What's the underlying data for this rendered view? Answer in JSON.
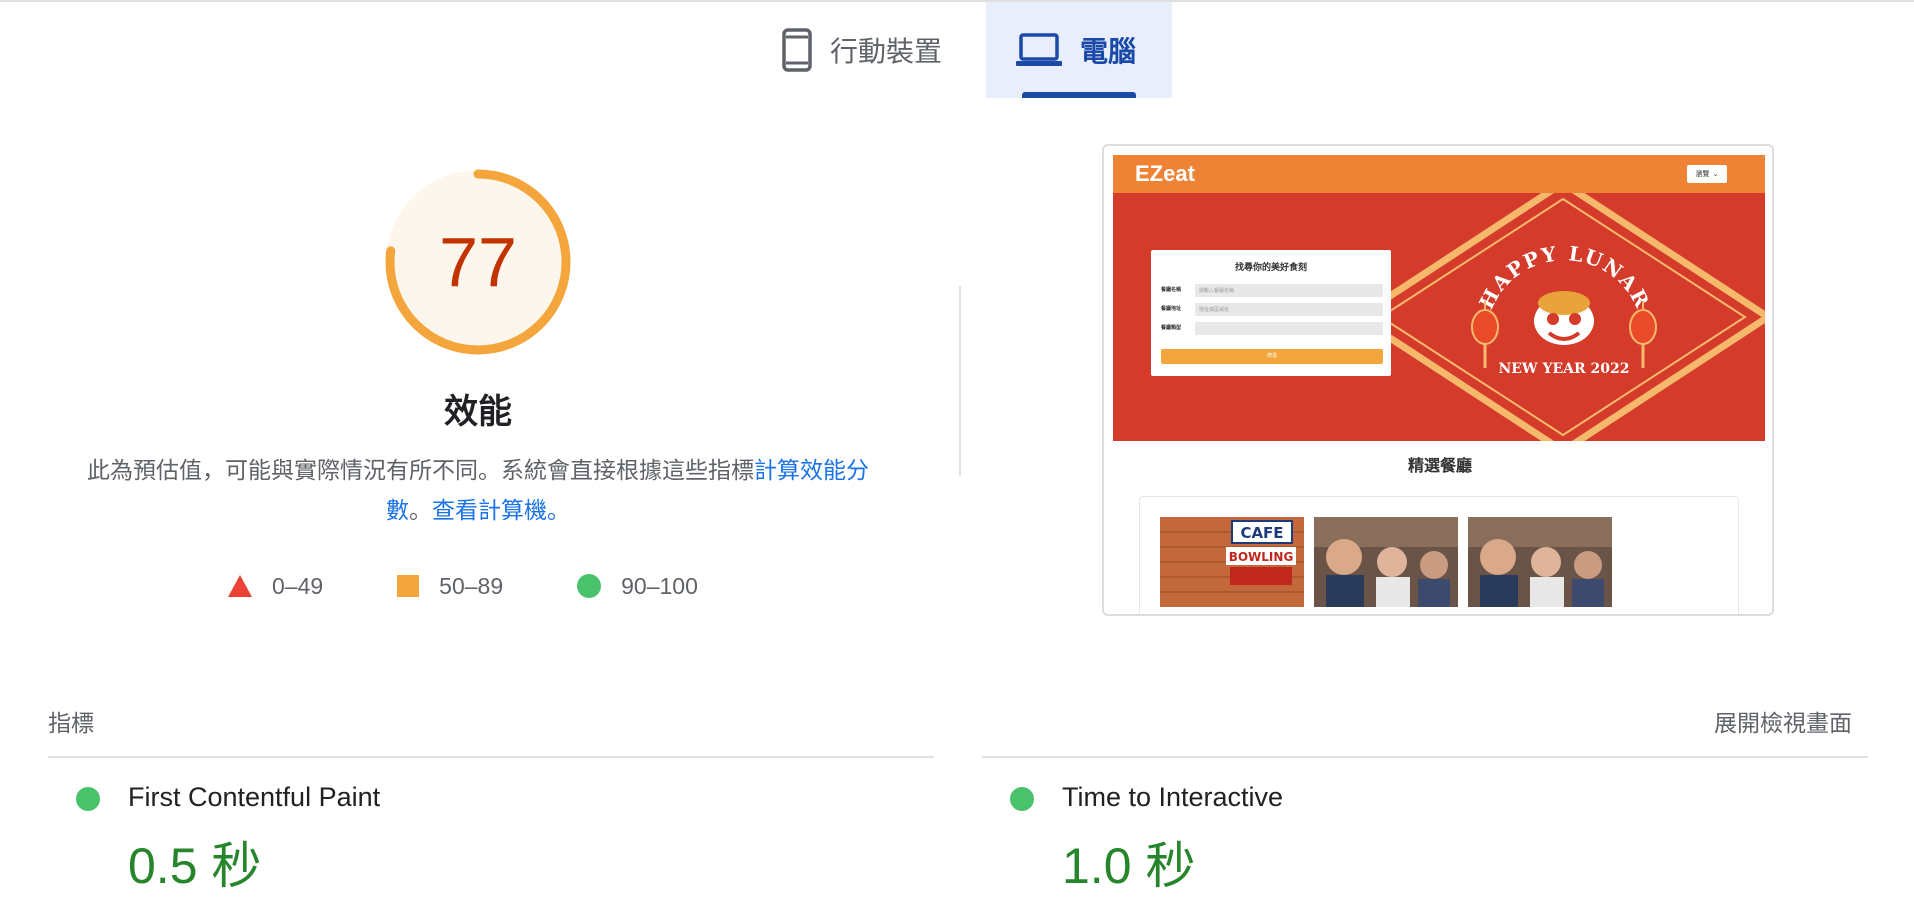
{
  "tabs": {
    "mobile_label": "行動裝置",
    "desktop_label": "電腦",
    "selected": "desktop"
  },
  "gauge": {
    "score": "77",
    "score_fraction": 0.77,
    "title": "效能",
    "color": "#f4a53b",
    "text_color": "#c33300"
  },
  "description": {
    "text": "此為預估值，可能與實際情況有所不同。系統會直接根據這些指標",
    "link1": "計算效能分數",
    "separator": "。",
    "link2": "查看計算機。"
  },
  "legend": [
    {
      "range": "0–49",
      "shape": "triangle",
      "color": "#eb4335"
    },
    {
      "range": "50–89",
      "shape": "square",
      "color": "#f4a53b"
    },
    {
      "range": "90–100",
      "shape": "circle",
      "color": "#4ac26b"
    }
  ],
  "screenshot": {
    "logo": "EZeat",
    "header_button": "瀏覽",
    "form_title": "找尋你的美好食刻",
    "form_fields": [
      {
        "label": "餐廳名稱",
        "placeholder": "請輸入餐廳名稱"
      },
      {
        "label": "餐廳地址",
        "placeholder": "地址或區域名"
      },
      {
        "label": "餐廳類型",
        "placeholder": ""
      }
    ],
    "form_submit": "搜尋",
    "banner_line1": "HAPPY LUNAR",
    "banner_line2": "NEW YEAR 2022",
    "featured_title": "精選餐廳",
    "cafe_sign": "CAFE",
    "bowling_sign": "BOWLING"
  },
  "metrics": {
    "header": "指標",
    "expand_label": "展開檢視畫面",
    "items": [
      {
        "name": "First Contentful Paint",
        "value": "0.5 秒",
        "status": "pass"
      },
      {
        "name": "Time to Interactive",
        "value": "1.0 秒",
        "status": "pass"
      }
    ]
  }
}
